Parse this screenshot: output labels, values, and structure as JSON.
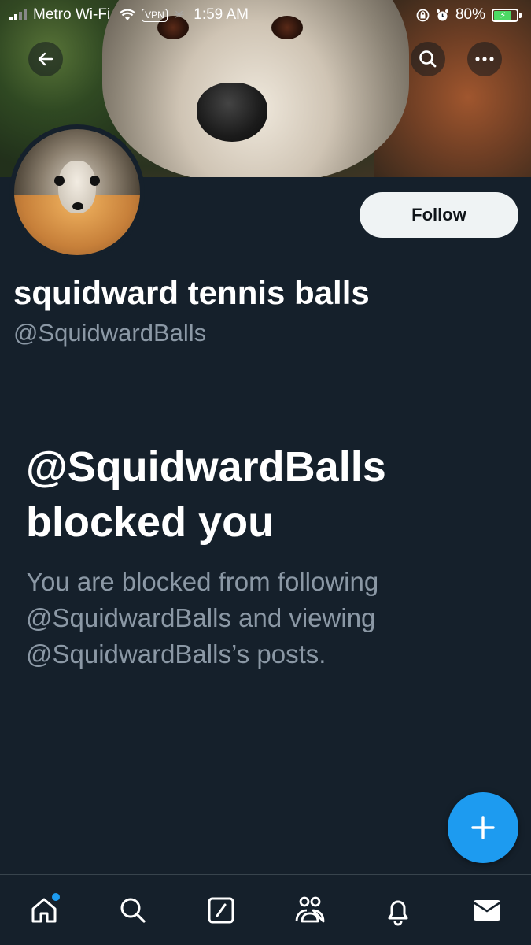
{
  "status_bar": {
    "carrier": "Metro Wi-Fi",
    "vpn": "VPN",
    "time": "1:59 AM",
    "battery": "80%",
    "battery_level": 0.8
  },
  "profile": {
    "display_name": "squidward tennis balls",
    "handle": "@SquidwardBalls",
    "follow_label": "Follow"
  },
  "blocked": {
    "title": "@SquidwardBalls blocked you",
    "description": "You are blocked from following @SquidwardBalls and viewing @SquidwardBalls’s posts."
  },
  "nav": {
    "items": [
      "home-icon",
      "search-icon",
      "compose-icon",
      "communities-icon",
      "notifications-icon",
      "messages-icon"
    ],
    "active": "home-icon",
    "accent": "#1d9bf0"
  },
  "colors": {
    "background": "#15202b",
    "accent": "#1d9bf0",
    "secondary_text": "#8b98a5"
  }
}
